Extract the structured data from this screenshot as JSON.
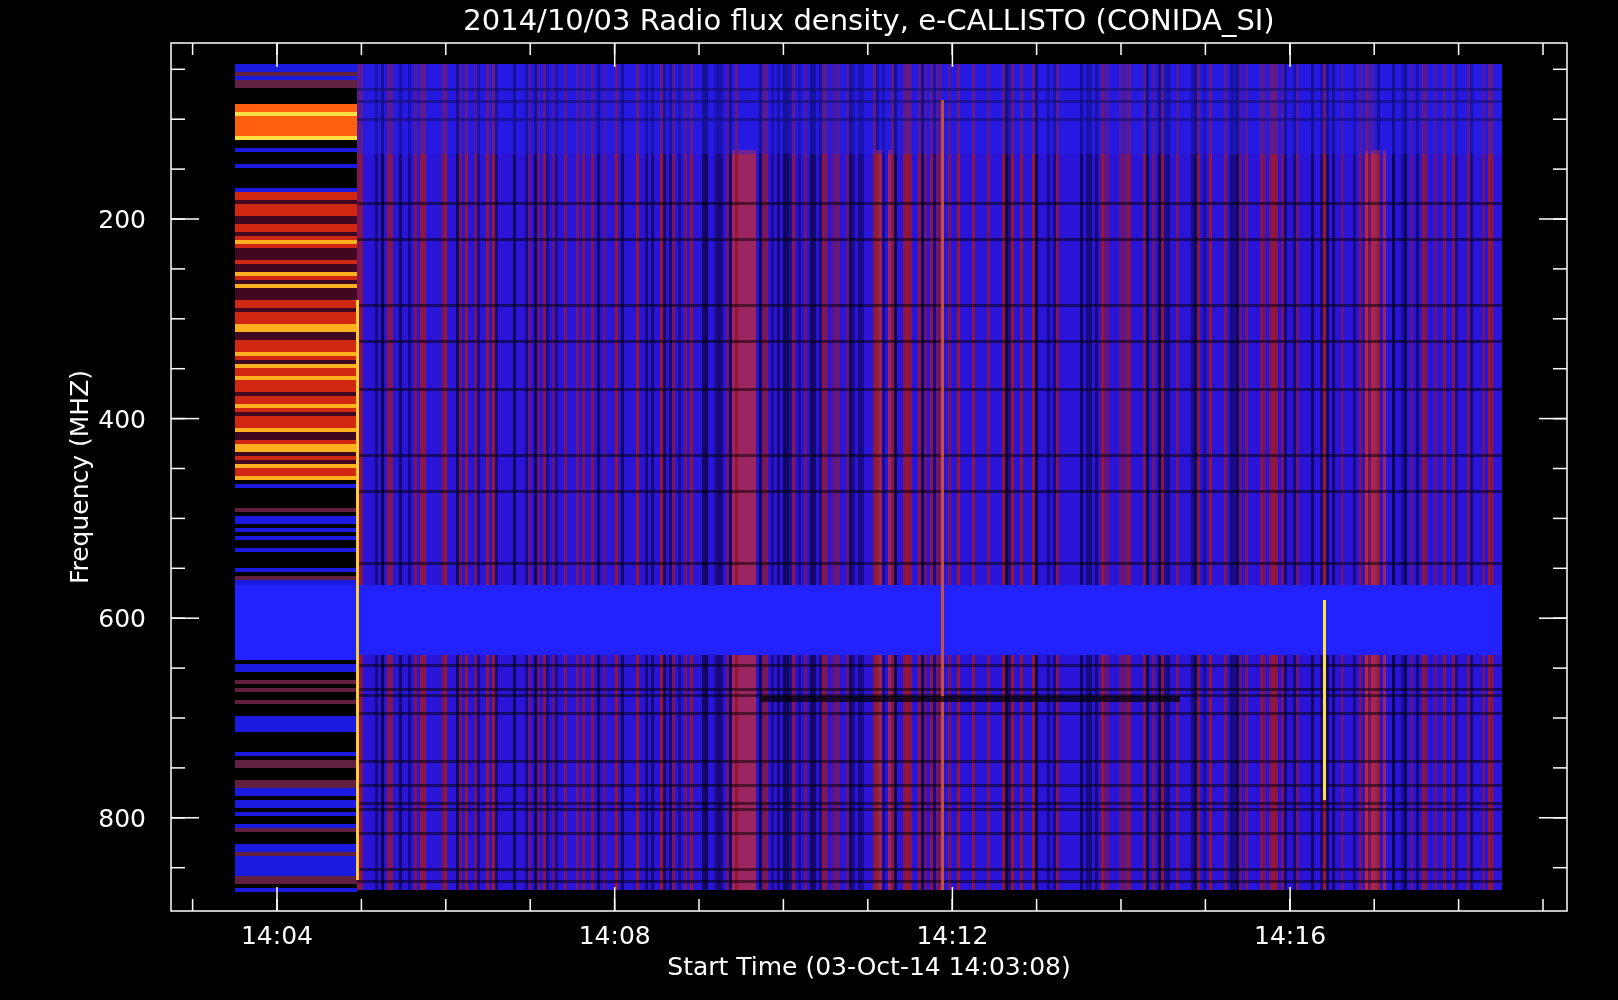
{
  "plot": {
    "title": "2014/10/03  Radio flux density, e-CALLISTO (CONIDA_SI)",
    "ylabel": "Frequency (MHZ)",
    "xlabel": "Start Time (03-Oct-14 14:03:08)",
    "yticks": [
      "200",
      "400",
      "600",
      "800"
    ],
    "xticks": [
      "14:04",
      "14:08",
      "14:12",
      "14:16"
    ]
  }
}
